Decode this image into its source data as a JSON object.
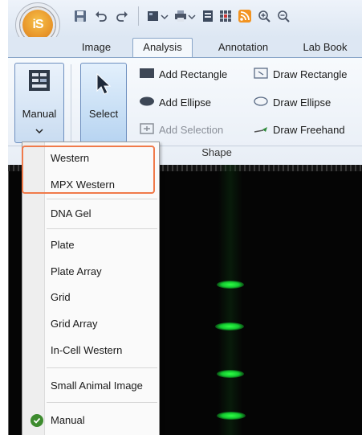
{
  "app": {
    "logo_text": "iS"
  },
  "tabs": [
    {
      "label": "Image"
    },
    {
      "label": "Analysis"
    },
    {
      "label": "Annotation"
    },
    {
      "label": "Lab Book"
    }
  ],
  "ribbon": {
    "manual_label": "Manual",
    "select_label": "Select",
    "commands": {
      "add_rectangle": "Add Rectangle",
      "add_ellipse": "Add Ellipse",
      "add_selection": "Add Selection",
      "draw_rectangle": "Draw Rectangle",
      "draw_ellipse": "Draw Ellipse",
      "draw_freehand": "Draw Freehand"
    },
    "group_label": "Shape"
  },
  "menu": {
    "items": [
      {
        "label": "Western"
      },
      {
        "label": "MPX Western"
      },
      {
        "label": "DNA Gel"
      },
      {
        "label": "Plate"
      },
      {
        "label": "Plate Array"
      },
      {
        "label": "Grid"
      },
      {
        "label": "Grid Array"
      },
      {
        "label": "In-Cell Western"
      },
      {
        "label": "Small Animal Image"
      },
      {
        "label": "Manual"
      }
    ],
    "checked_item": "Manual"
  },
  "colors": {
    "highlight": "#f07a4a",
    "ribbon_accent": "#8aa6c8",
    "check": "#3d8b2e",
    "band": "#2fff45"
  }
}
